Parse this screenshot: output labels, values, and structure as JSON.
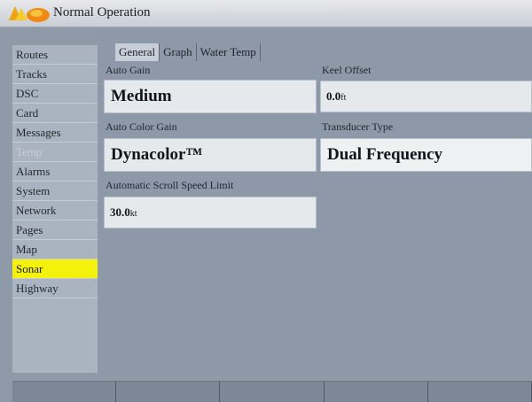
{
  "title": "Normal Operation",
  "sidebar": {
    "items": [
      {
        "label": "Routes",
        "state": "normal"
      },
      {
        "label": "Tracks",
        "state": "normal"
      },
      {
        "label": "DSC",
        "state": "normal"
      },
      {
        "label": "Card",
        "state": "normal"
      },
      {
        "label": "Messages",
        "state": "normal"
      },
      {
        "label": "Temp",
        "state": "disabled"
      },
      {
        "label": "Alarms",
        "state": "normal"
      },
      {
        "label": "System",
        "state": "normal"
      },
      {
        "label": "Network",
        "state": "normal"
      },
      {
        "label": "Pages",
        "state": "normal"
      },
      {
        "label": "Map",
        "state": "normal"
      },
      {
        "label": "Sonar",
        "state": "selected"
      },
      {
        "label": "Highway",
        "state": "normal"
      }
    ]
  },
  "tabs": [
    {
      "label": "General",
      "active": true
    },
    {
      "label": "Graph",
      "active": false
    },
    {
      "label": "Water Temp",
      "active": false
    }
  ],
  "fields": {
    "auto_gain": {
      "label": "Auto Gain",
      "value": "Medium"
    },
    "keel_offset": {
      "label": "Keel Offset",
      "value": "0.0",
      "unit": "ft"
    },
    "auto_color_gain": {
      "label": "Auto Color Gain",
      "value": "Dynacolor™"
    },
    "transducer_type": {
      "label": "Transducer Type",
      "value": "Dual Frequency"
    },
    "scroll_speed_limit": {
      "label": "Automatic Scroll Speed Limit",
      "value": "30.0",
      "unit": "kt"
    }
  },
  "colors": {
    "selected_highlight": "#f4f20a",
    "background": "#8e9aa8"
  },
  "icons": {
    "app_logo": "garmin-logo-icon"
  }
}
